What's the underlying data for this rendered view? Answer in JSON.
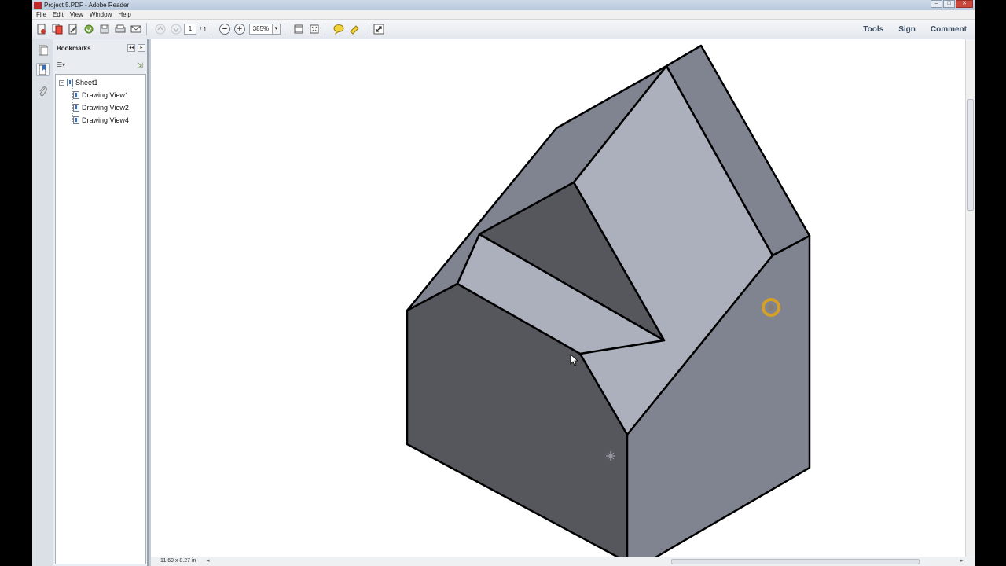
{
  "window": {
    "title": "Project 5.PDF - Adobe Reader",
    "controls": [
      "–",
      "□",
      "✕"
    ]
  },
  "menu": [
    "File",
    "Edit",
    "View",
    "Window",
    "Help"
  ],
  "toolbar": {
    "page_current": "1",
    "page_total": "/ 1",
    "zoom_value": "385%",
    "zoom_dropdown_glyph": "▾",
    "zoom_out_glyph": "−",
    "zoom_in_glyph": "+",
    "right_links": [
      "Tools",
      "Sign",
      "Comment"
    ],
    "icons": [
      "create-pdf-icon",
      "combine-icon",
      "edit-icon",
      "cloud-icon",
      "save-icon",
      "print-icon",
      "email-icon",
      "prev-page-icon",
      "next-page-icon",
      "fit-page-icon",
      "full-screen-icon",
      "comment-icon",
      "highlight-icon",
      "read-mode-icon"
    ]
  },
  "sidebar": {
    "panel_title": "Bookmarks",
    "options_glyph": "☰▾",
    "add_glyph": "⇲",
    "collapse_glyph": "◂◂",
    "close_glyph": "▸",
    "tree": {
      "root_label": "Sheet1",
      "root_toggle": "−",
      "children": [
        "Drawing View1",
        "Drawing View2",
        "Drawing View4"
      ]
    }
  },
  "statusbar": {
    "page_size": "11.69 x 8.27 in",
    "scroll_left_glyph": "◂",
    "scroll_right_glyph": "▸"
  },
  "colors": {
    "face_light": "#abb0bc",
    "face_mid": "#7f8490",
    "face_dark": "#55575d",
    "edge": "#000000",
    "cursor_ring": "#e0a21c"
  }
}
